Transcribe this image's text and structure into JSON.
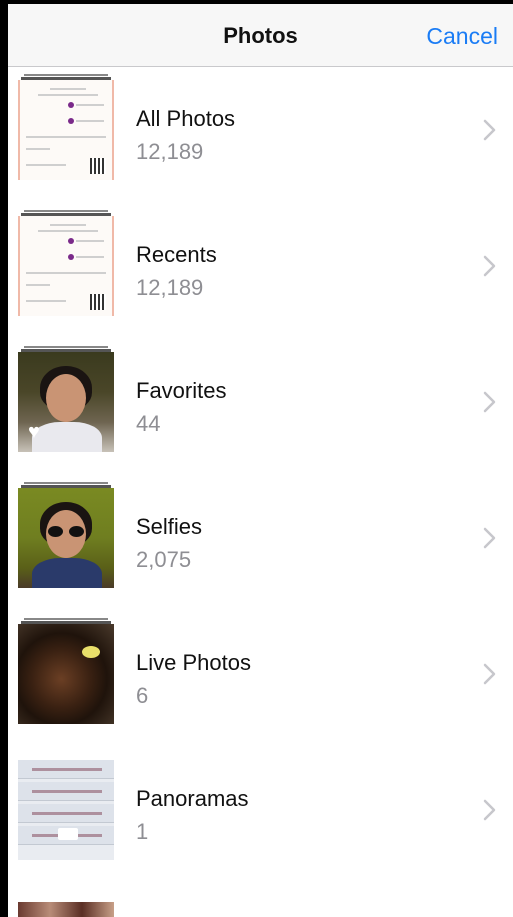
{
  "navbar": {
    "title": "Photos",
    "cancel_label": "Cancel"
  },
  "albums": [
    {
      "label": "All Photos",
      "count": "12,189"
    },
    {
      "label": "Recents",
      "count": "12,189"
    },
    {
      "label": "Favorites",
      "count": "44"
    },
    {
      "label": "Selfies",
      "count": "2,075"
    },
    {
      "label": "Live Photos",
      "count": "6"
    },
    {
      "label": "Panoramas",
      "count": "1"
    }
  ],
  "colors": {
    "accent": "#1a7cf5",
    "secondary_text": "#8e8e93"
  },
  "icons": {
    "chevron": "chevron-right-icon",
    "favorite": "heart-icon",
    "panorama": "panorama-icon"
  }
}
